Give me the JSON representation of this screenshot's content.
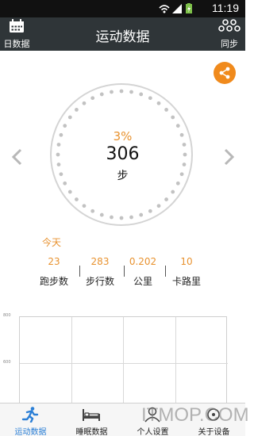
{
  "status_bar": {
    "time": "11:19",
    "icons": [
      "wifi-icon",
      "signal-icon",
      "battery-charging-icon"
    ]
  },
  "header": {
    "title": "运动数据",
    "left_label": "日数据",
    "left_icon": "calendar-icon",
    "right_label": "同步",
    "right_icon": "sync-icon"
  },
  "share_icon": "share-icon",
  "dial": {
    "percent": "3%",
    "steps": "306",
    "unit": "步"
  },
  "today": {
    "label": "今天"
  },
  "stats": [
    {
      "value": "23",
      "label": "跑步数"
    },
    {
      "value": "283",
      "label": "步行数"
    },
    {
      "value": "0.202",
      "label": "公里"
    },
    {
      "value": "10",
      "label": "卡路里"
    }
  ],
  "chart": {
    "y_ticks": [
      "800",
      "600"
    ]
  },
  "tabs": [
    {
      "label": "运动数据",
      "icon": "running-icon",
      "active": true
    },
    {
      "label": "睡眠数据",
      "icon": "bed-icon",
      "active": false
    },
    {
      "label": "个人设置",
      "icon": "person-icon",
      "active": false
    },
    {
      "label": "关于设备",
      "icon": "device-icon",
      "active": false
    }
  ],
  "watermark": "ITMOP.COM",
  "colors": {
    "accent": "#e8922f",
    "header_bg": "#2f3538",
    "tab_active": "#2b7fd6"
  }
}
